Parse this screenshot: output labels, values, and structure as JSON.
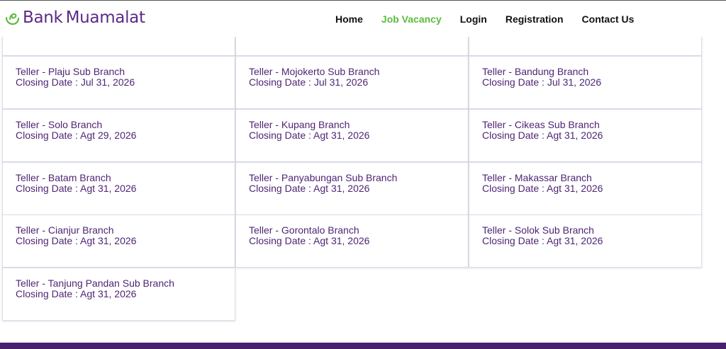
{
  "brand": {
    "name_part1": "Bank",
    "name_part2": "Muamalat",
    "logo_icon": "muamalat-logo-icon",
    "color": "#5b2a86",
    "accent": "#5cbc3e"
  },
  "nav": {
    "items": [
      {
        "label": "Home",
        "active": false
      },
      {
        "label": "Job Vacancy",
        "active": true
      },
      {
        "label": "Login",
        "active": false
      },
      {
        "label": "Registration",
        "active": false
      },
      {
        "label": "Contact Us",
        "active": false
      }
    ]
  },
  "jobs": [
    {
      "title": "Teller - Plaju Sub Branch",
      "closing": "Closing Date : Jul 31, 2026"
    },
    {
      "title": "Teller - Mojokerto Sub Branch",
      "closing": "Closing Date : Jul 31, 2026"
    },
    {
      "title": "Teller - Bandung Branch",
      "closing": "Closing Date : Jul 31, 2026"
    },
    {
      "title": "Teller - Solo Branch",
      "closing": "Closing Date : Agt 29, 2026"
    },
    {
      "title": "Teller - Kupang Branch",
      "closing": "Closing Date : Agt 31, 2026"
    },
    {
      "title": "Teller - Cikeas Sub Branch",
      "closing": "Closing Date : Agt 31, 2026"
    },
    {
      "title": "Teller - Batam Branch",
      "closing": "Closing Date : Agt 31, 2026"
    },
    {
      "title": "Teller - Panyabungan Sub Branch",
      "closing": "Closing Date : Agt 31, 2026"
    },
    {
      "title": "Teller - Makassar Branch",
      "closing": "Closing Date : Agt 31, 2026"
    },
    {
      "title": "Teller - Cianjur Branch",
      "closing": "Closing Date : Agt 31, 2026"
    },
    {
      "title": "Teller - Gorontalo Branch",
      "closing": "Closing Date : Agt 31, 2026"
    },
    {
      "title": "Teller - Solok Sub Branch",
      "closing": "Closing Date : Agt 31, 2026"
    },
    {
      "title": "Teller - Tanjung Pandan Sub Branch",
      "closing": "Closing Date : Agt 31, 2026"
    }
  ],
  "colors": {
    "card_text": "#4e2574",
    "footer": "#4b1f6f"
  }
}
